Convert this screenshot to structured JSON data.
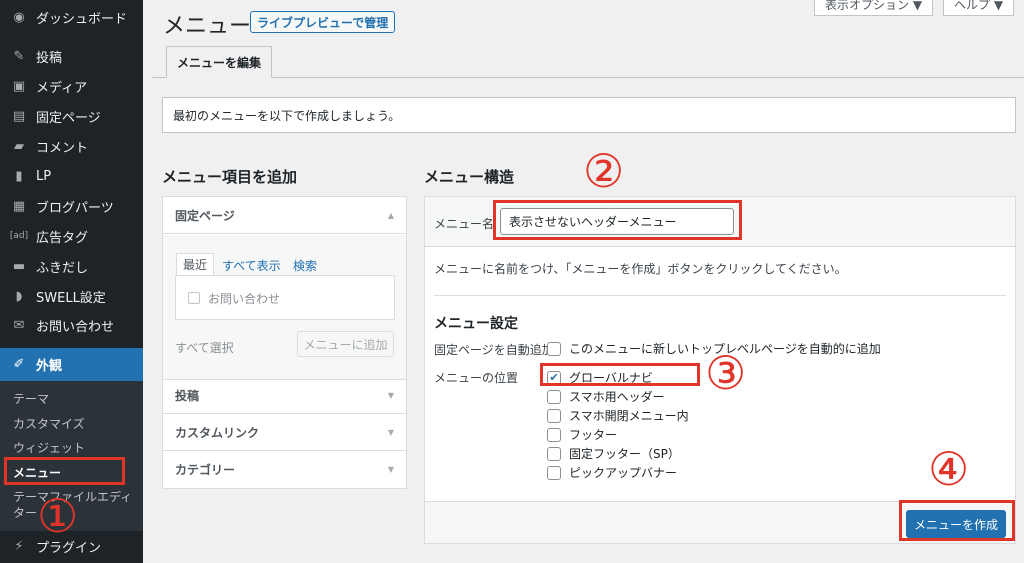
{
  "sidebar": {
    "items": [
      {
        "icon": "dashboard-icon",
        "glyph": "◉",
        "label": "ダッシュボード"
      },
      {
        "icon": "pin-icon",
        "glyph": "✎",
        "label": "投稿"
      },
      {
        "icon": "media-icon",
        "glyph": "▣",
        "label": "メディア"
      },
      {
        "icon": "page-icon",
        "glyph": "▤",
        "label": "固定ページ"
      },
      {
        "icon": "comment-icon",
        "glyph": "▰",
        "label": "コメント"
      },
      {
        "icon": "document-icon",
        "glyph": "▮",
        "label": "LP"
      },
      {
        "icon": "blocks-icon",
        "glyph": "▦",
        "label": "ブログパーツ"
      },
      {
        "icon": "ad-icon",
        "glyph": "[ad]",
        "label": "広告タグ"
      },
      {
        "icon": "speech-bubble-icon",
        "glyph": "▬",
        "label": "ふきだし"
      },
      {
        "icon": "swell-icon",
        "glyph": "◗",
        "label": "SWELL設定"
      },
      {
        "icon": "mail-icon",
        "glyph": "✉",
        "label": "お問い合わせ"
      },
      {
        "icon": "brush-icon",
        "glyph": "✐",
        "label": "外観"
      },
      {
        "icon": "plugin-icon",
        "glyph": "⚡",
        "label": "プラグイン"
      }
    ],
    "submenu": [
      "テーマ",
      "カスタマイズ",
      "ウィジェット",
      "メニュー",
      "テーマファイルエディ",
      "ター"
    ]
  },
  "header": {
    "title": "メニュー",
    "live_preview": "ライブプレビューで管理",
    "screen_options": "表示オプション ▼",
    "help": "ヘルプ ▼"
  },
  "tabs": {
    "edit": "メニューを編集"
  },
  "notice": "最初のメニューを以下で作成しましょう。",
  "add_items": {
    "title": "メニュー項目を追加",
    "pages_heading": "固定ページ",
    "tab_recent": "最近",
    "tab_all": "すべて表示",
    "tab_search": "検索",
    "page_item": "お問い合わせ",
    "select_all": "すべて選択",
    "add_button": "メニューに追加",
    "posts": "投稿",
    "custom_links": "カスタムリンク",
    "categories": "カテゴリー"
  },
  "structure": {
    "title": "メニュー構造",
    "name_label": "メニュー名",
    "name_value": "表示させないヘッダーメニュー",
    "instruction": "メニューに名前をつけ、「メニューを作成」ボタンをクリックしてください。",
    "settings_title": "メニュー設定",
    "auto_add_label": "固定ページを自動追加",
    "auto_add_option": "このメニューに新しいトップレベルページを自動的に追加",
    "location_label": "メニューの位置",
    "locations": [
      {
        "label": "グローバルナビ",
        "checked": true
      },
      {
        "label": "スマホ用ヘッダー",
        "checked": false
      },
      {
        "label": "スマホ開閉メニュー内",
        "checked": false
      },
      {
        "label": "フッター",
        "checked": false
      },
      {
        "label": "固定フッター（SP）",
        "checked": false
      },
      {
        "label": "ピックアップバナー",
        "checked": false
      }
    ],
    "create_button": "メニューを作成"
  },
  "annotations": {
    "one": "①",
    "two": "②",
    "three": "③",
    "four": "④",
    "color": "#e1352a"
  },
  "colors": {
    "accent": "#2271b1",
    "sidebar": "#1d2327"
  }
}
